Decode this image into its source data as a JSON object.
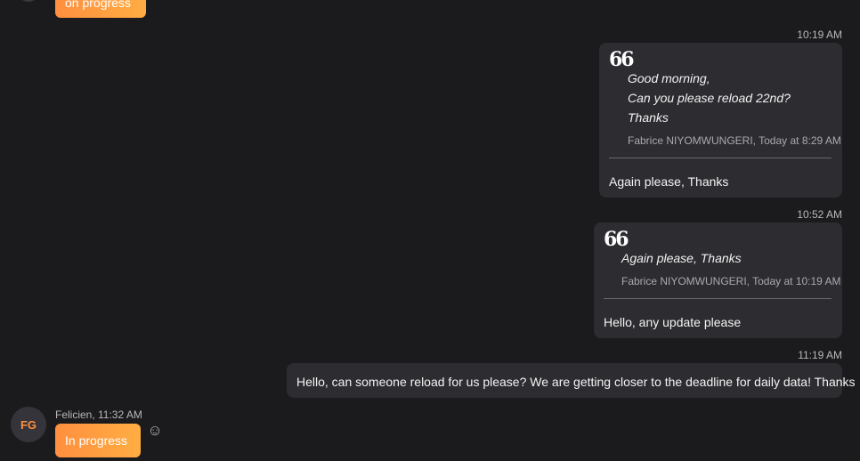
{
  "top_message": {
    "text": "on progress"
  },
  "messages": [
    {
      "time": "10:19 AM",
      "quote_icon": "66",
      "quote_lines": [
        "Good morning,",
        "Can you please reload 22nd?",
        "Thanks"
      ],
      "quote_author": "Fabrice NIYOMWUNGERI, Today at 8:29 AM",
      "body": "Again please, Thanks"
    },
    {
      "time": "10:52 AM",
      "quote_icon": "66",
      "quote_lines": [
        "Again please, Thanks"
      ],
      "quote_author": "Fabrice NIYOMWUNGERI, Today at 10:19 AM",
      "body": "Hello, any update please"
    },
    {
      "time": "11:19 AM",
      "body": "Hello, can someone reload for us please? We are getting closer to the deadline for daily data! Thanks"
    }
  ],
  "incoming": {
    "avatar_initials": "FG",
    "sender": "Felicien, 11:32 AM",
    "text": "In progress",
    "reaction_icon": "smiley-icon"
  },
  "colors": {
    "background": "#1b1b1d",
    "bubble": "#2c2c31",
    "accent": "#ff8f3f"
  }
}
